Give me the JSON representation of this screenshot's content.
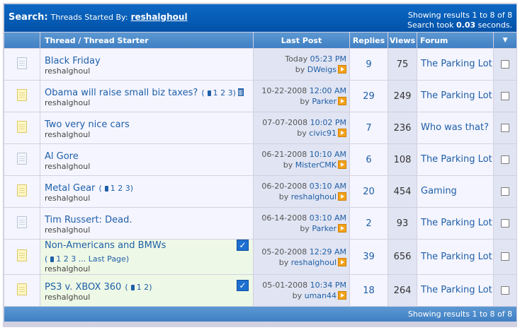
{
  "header": {
    "search_label": "Search:",
    "subtitle": "Threads Started By:",
    "username": "reshalghoul",
    "showing": "Showing results 1 to 8 of 8",
    "search_took_prefix": "Search took",
    "search_took_value": "0.03",
    "search_took_suffix": "seconds."
  },
  "columns": {
    "thread": "Thread / Thread Starter",
    "last_post": "Last Post",
    "replies": "Replies",
    "views": "Views",
    "forum": "Forum",
    "menu_arrow": "▼"
  },
  "rows": [
    {
      "title": "Black Friday",
      "pages": "",
      "starter": "reshalghoul",
      "date": "Today",
      "time": "05:23 PM",
      "by": "by",
      "last_user": "DWeigs",
      "replies": "9",
      "views": "75",
      "forum": "The Parking Lot",
      "icon": "grey"
    },
    {
      "title": "Obama will raise small biz taxes?",
      "pages": "1 2 3",
      "starter": "reshalghoul",
      "date": "10-22-2008",
      "time": "12:00 AM",
      "by": "by",
      "last_user": "Parker",
      "replies": "29",
      "views": "249",
      "forum": "The Parking Lot",
      "icon": "yellow"
    },
    {
      "title": "Two very nice cars",
      "pages": "",
      "starter": "reshalghoul",
      "date": "07-07-2008",
      "time": "10:02 PM",
      "by": "by",
      "last_user": "civic91",
      "replies": "7",
      "views": "236",
      "forum": "Who was that?",
      "icon": "yellow"
    },
    {
      "title": "Al Gore",
      "pages": "",
      "starter": "reshalghoul",
      "date": "06-21-2008",
      "time": "10:10 AM",
      "by": "by",
      "last_user": "MisterCMK",
      "replies": "6",
      "views": "108",
      "forum": "The Parking Lot",
      "icon": "grey"
    },
    {
      "title": "Metal Gear",
      "pages": "1 2 3",
      "starter": "reshalghoul",
      "date": "06-20-2008",
      "time": "03:10 AM",
      "by": "by",
      "last_user": "reshalghoul",
      "replies": "20",
      "views": "454",
      "forum": "Gaming",
      "icon": "yellow"
    },
    {
      "title": "Tim Russert: Dead.",
      "pages": "",
      "starter": "reshalghoul",
      "date": "06-14-2008",
      "time": "03:10 AM",
      "by": "by",
      "last_user": "Parker",
      "replies": "2",
      "views": "93",
      "forum": "The Parking Lot",
      "icon": "grey"
    },
    {
      "title": "Non-Americans and BMWs",
      "pages": "1 2 3 ... Last Page",
      "starter": "reshalghoul",
      "date": "05-20-2008",
      "time": "12:29 AM",
      "by": "by",
      "last_user": "reshalghoul",
      "replies": "39",
      "views": "656",
      "forum": "The Parking Lot",
      "icon": "yellow"
    },
    {
      "title": "PS3 v. XBOX 360",
      "pages": "1 2",
      "starter": "reshalghoul",
      "date": "05-01-2008",
      "time": "10:34 PM",
      "by": "by",
      "last_user": "uman44",
      "replies": "18",
      "views": "264",
      "forum": "The Parking Lot",
      "icon": "yellow"
    }
  ],
  "footer": {
    "showing": "Showing results 1 to 8 of 8"
  },
  "colors": {
    "title_bar": "#0252a8",
    "header_bar": "#4a88c9",
    "link": "#1e5fa8",
    "row_bg": "#f5f5ff",
    "alt_bg": "#e1e4f2",
    "highlight_bg": "#eef8e6"
  }
}
